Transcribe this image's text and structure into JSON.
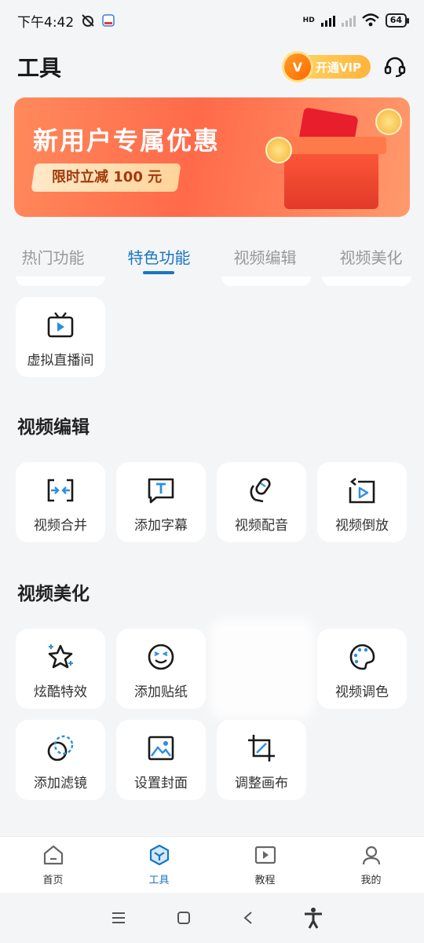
{
  "status_bar": {
    "time": "下午4:42",
    "battery": "64",
    "network_label": "HD"
  },
  "header": {
    "title": "工具",
    "vip_label": "开通VIP"
  },
  "banner": {
    "title": "新用户专属优惠",
    "subtitle": "限时立减 100 元"
  },
  "tabs": [
    {
      "label": "热门功能",
      "active": false
    },
    {
      "label": "特色功能",
      "active": true
    },
    {
      "label": "视频编辑",
      "active": false
    },
    {
      "label": "视频美化",
      "active": false
    }
  ],
  "featured": {
    "items": [
      {
        "label": "虚拟直播间",
        "icon": "tv-play-icon"
      }
    ]
  },
  "video_edit": {
    "title": "视频编辑",
    "items": [
      {
        "label": "视频合并",
        "icon": "merge-icon"
      },
      {
        "label": "添加字幕",
        "icon": "subtitle-icon"
      },
      {
        "label": "视频配音",
        "icon": "mic-icon"
      },
      {
        "label": "视频倒放",
        "icon": "reverse-play-icon"
      }
    ]
  },
  "video_beautify": {
    "title": "视频美化",
    "items": [
      {
        "label": "炫酷特效",
        "icon": "star-sparkle-icon"
      },
      {
        "label": "添加贴纸",
        "icon": "sticker-face-icon"
      },
      {
        "label": "视频调色",
        "icon": "palette-icon"
      },
      {
        "label": "添加滤镜",
        "icon": "filter-icon"
      },
      {
        "label": "设置封面",
        "icon": "image-icon"
      },
      {
        "label": "调整画布",
        "icon": "crop-icon"
      }
    ]
  },
  "bottom_nav": [
    {
      "label": "首页",
      "icon": "home-icon",
      "active": false
    },
    {
      "label": "工具",
      "icon": "tools-cube-icon",
      "active": true
    },
    {
      "label": "教程",
      "icon": "tutorial-play-icon",
      "active": false
    },
    {
      "label": "我的",
      "icon": "profile-icon",
      "active": false
    }
  ],
  "colors": {
    "accent": "#1976c2",
    "icon": "#1a1a1a",
    "icon_accent": "#2a8fe0",
    "banner": "#ff6a4a"
  }
}
